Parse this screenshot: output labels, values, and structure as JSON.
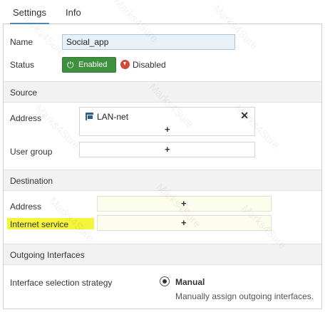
{
  "tabs": {
    "settings": "Settings",
    "info": "Info"
  },
  "general": {
    "name_label": "Name",
    "name_value": "Social_app",
    "status_label": "Status",
    "enabled_label": "Enabled",
    "disabled_label": "Disabled"
  },
  "source": {
    "header": "Source",
    "address_label": "Address",
    "address_value": "LAN-net",
    "remove_glyph": "✕",
    "add_glyph": "+",
    "user_group_label": "User group"
  },
  "destination": {
    "header": "Destination",
    "address_label": "Address",
    "internet_service_label": "Internet service",
    "add_glyph": "+"
  },
  "outgoing": {
    "header": "Outgoing Interfaces",
    "strategy_label": "Interface selection strategy",
    "option_label": "Manual",
    "option_hint": "Manually assign outgoing interfaces."
  },
  "watermark": "Marks4Sure",
  "colors": {
    "enabled": "#3e8f3e",
    "disabled_icon": "#d04a3b",
    "tab_accent": "#4a8ab8",
    "highlight": "#f4f43a"
  },
  "icons": {
    "enabled": "power-icon",
    "disabled": "arrow-down-circle-icon",
    "address": "network-icon",
    "remove": "close-icon",
    "add": "plus-icon"
  }
}
